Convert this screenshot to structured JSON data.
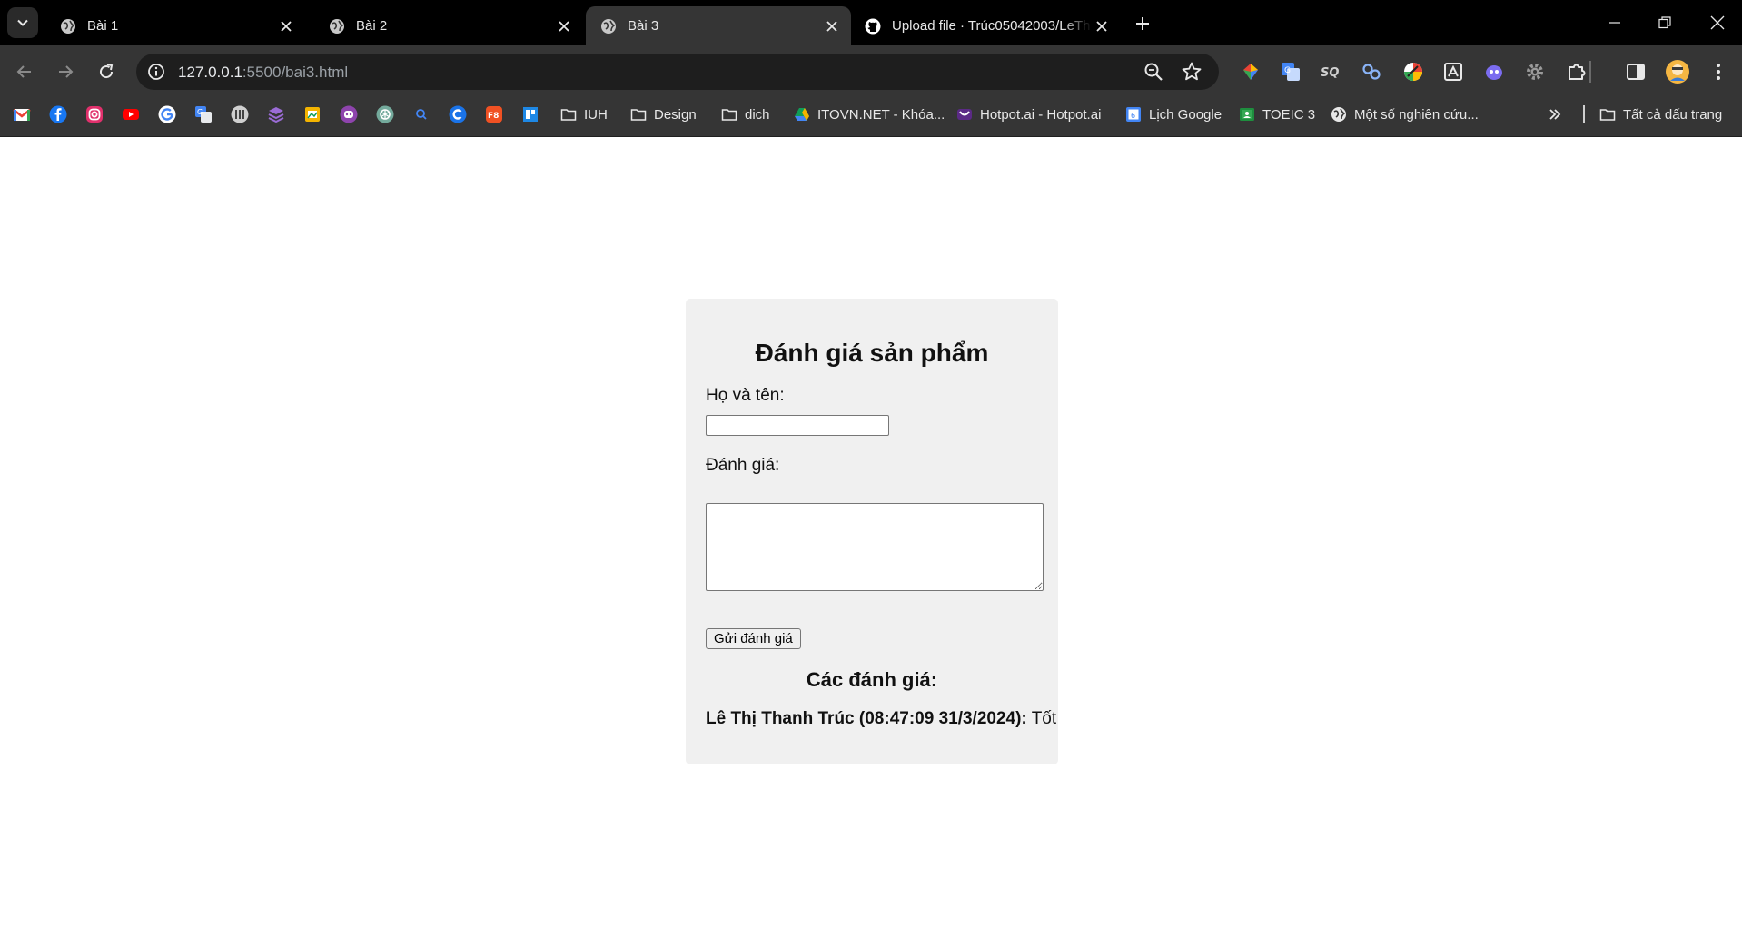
{
  "browser": {
    "tabs": [
      {
        "title": "Bài 1",
        "active": false
      },
      {
        "title": "Bài 2",
        "active": false
      },
      {
        "title": "Bài 3",
        "active": true
      },
      {
        "title": "Upload file · Trúc05042003/LeTh",
        "active": false
      }
    ],
    "address": {
      "host": "127.0.0.1",
      "path": ":5500/bai3.html"
    },
    "bookmark_folders": [
      {
        "label": "IUH"
      },
      {
        "label": "Design"
      },
      {
        "label": "dich"
      }
    ],
    "bookmarks": [
      {
        "label": "ITOVN.NET - Khóa..."
      },
      {
        "label": "Hotpot.ai - Hotpot.ai"
      },
      {
        "label": "Lịch Google"
      },
      {
        "label": "TOEIC 3"
      },
      {
        "label": "Một số nghiên cứu..."
      }
    ],
    "all_bookmarks_label": "Tất cả dấu trang",
    "icon_only_bookmarks": [
      "gmail-icon",
      "facebook-icon",
      "instagram-icon",
      "youtube-icon",
      "google-icon",
      "google-translate-icon",
      "app-icon",
      "stack-icon",
      "sheets-icon",
      "chat-bot-icon",
      "chatgpt-icon",
      "search-icon",
      "c-icon",
      "f8-icon",
      "board-icon"
    ],
    "extensions": [
      "color-picker-icon",
      "translate-icon",
      "sq-icon",
      "link-icon",
      "color-wheel-icon",
      "download-icon",
      "alien-icon",
      "gear-icon",
      "puzzle-icon"
    ]
  },
  "page": {
    "heading": "Đánh giá sản phẩm",
    "name_label": "Họ và tên:",
    "name_value": "",
    "review_label": "Đánh giá:",
    "review_value": "",
    "submit_label": "Gửi đánh giá",
    "reviews_heading": "Các đánh giá:",
    "reviews": [
      {
        "author": "Lê Thị Thanh Trúc",
        "time": "(08:47:09 31/3/2024):",
        "text": "Tốt"
      }
    ]
  },
  "colors": {
    "tab_strip": "#000000",
    "toolbar": "#353535",
    "card_bg": "#f0f0f0"
  }
}
